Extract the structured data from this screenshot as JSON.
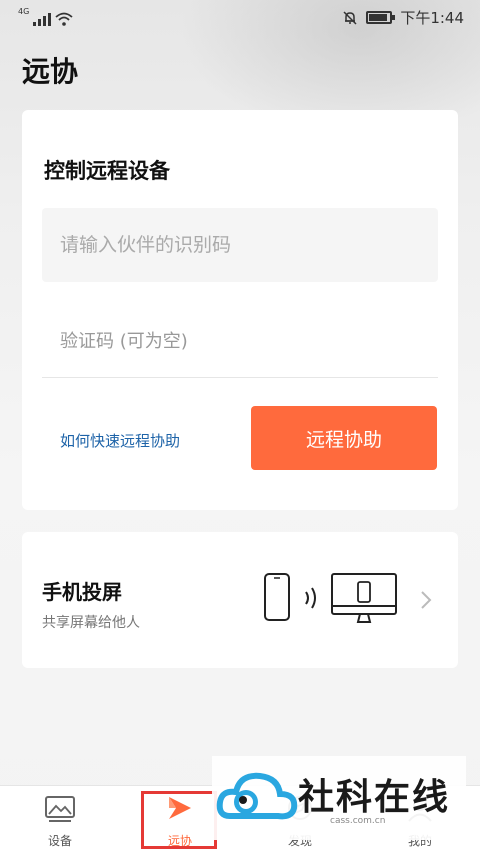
{
  "status_bar": {
    "network_type": "4G",
    "time": "下午1:44",
    "battery_level": 0.9
  },
  "header": {
    "title": "远协"
  },
  "remote_card": {
    "title": "控制远程设备",
    "partner_id_placeholder": "请输入伙伴的识别码",
    "code_placeholder": "验证码 (可为空)",
    "help_link": "如何快速远程协助",
    "assist_button": "远程协助"
  },
  "cast_card": {
    "title": "手机投屏",
    "subtitle": "共享屏幕给他人"
  },
  "bottom_nav": {
    "items": [
      {
        "label": "设备",
        "icon": "device-image-icon"
      },
      {
        "label": "远协",
        "icon": "remote-assist-icon"
      },
      {
        "label": "发现",
        "icon": "discover-icon"
      },
      {
        "label": "我的",
        "icon": "profile-icon"
      }
    ],
    "active_index": 1
  },
  "watermark": {
    "text": "社科在线",
    "url": "cass.com.cn"
  },
  "colors": {
    "accent": "#ff6a3d",
    "link": "#1d63a8",
    "highlight_box": "#e53935"
  }
}
